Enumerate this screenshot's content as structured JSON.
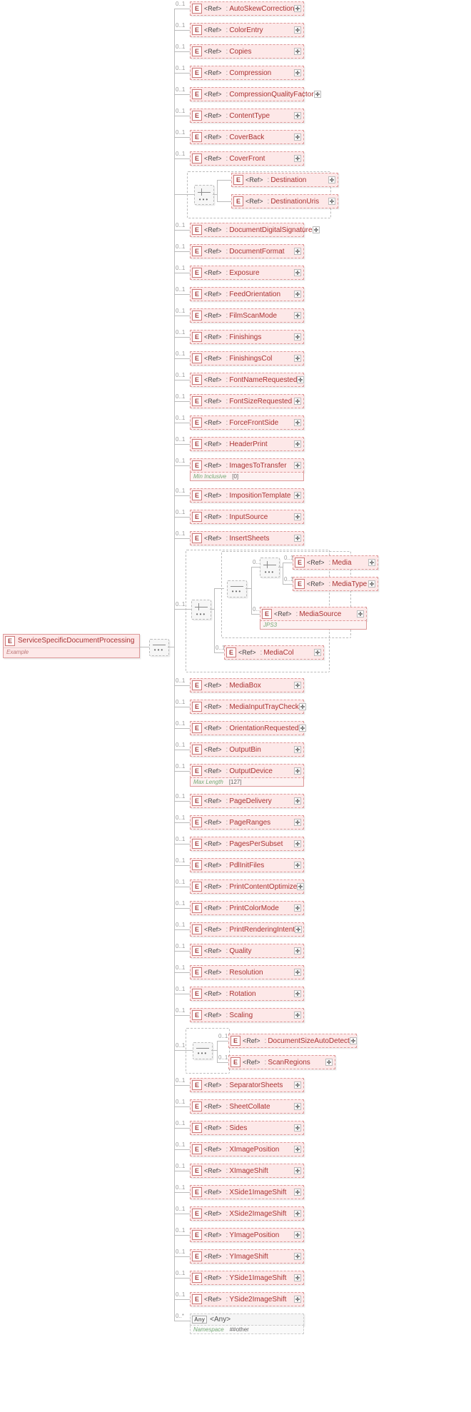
{
  "root": {
    "tag": "E",
    "name": "ServiceSpecificDocumentProcessing",
    "subLabel": "Example"
  },
  "ref_label": "<Ref>",
  "colon": ":",
  "occ_default": "0..1",
  "occ_any": "0..*",
  "occ_choice_inner": "0..1",
  "constraints": {
    "minInclusive_k": "Min Inclusive",
    "minInclusive_v": "[0]",
    "maxLength_k": "Max Length",
    "maxLength_v": "[127]",
    "jps3": "JPS3",
    "namespace_k": "Namespace",
    "namespace_v": "##other"
  },
  "children": [
    {
      "name": "AutoSkewCorrection"
    },
    {
      "name": "ColorEntry"
    },
    {
      "name": "Copies"
    },
    {
      "name": "Compression"
    },
    {
      "name": "CompressionQualityFactor"
    },
    {
      "name": "ContentType"
    },
    {
      "name": "CoverBack"
    },
    {
      "name": "CoverFront"
    },
    {
      "choice": [
        {
          "name": "Destination"
        },
        {
          "name": "DestinationUris"
        }
      ]
    },
    {
      "name": "DocumentDigitalSignature"
    },
    {
      "name": "DocumentFormat"
    },
    {
      "name": "Exposure"
    },
    {
      "name": "FeedOrientation"
    },
    {
      "name": "FilmScanMode"
    },
    {
      "name": "Finishings"
    },
    {
      "name": "FinishingsCol"
    },
    {
      "name": "FontNameRequested"
    },
    {
      "name": "FontSizeRequested"
    },
    {
      "name": "ForceFrontSide"
    },
    {
      "name": "HeaderPrint"
    },
    {
      "name": "ImagesToTransfer",
      "sub": "minInclusive"
    },
    {
      "name": "ImpositionTemplate"
    },
    {
      "name": "InputSource"
    },
    {
      "name": "InsertSheets"
    },
    {
      "media_group": true
    },
    {
      "name": "MediaBox"
    },
    {
      "name": "MediaInputTrayCheck"
    },
    {
      "name": "OrientationRequested"
    },
    {
      "name": "OutputBin"
    },
    {
      "name": "OutputDevice",
      "sub": "maxLength"
    },
    {
      "name": "PageDelivery"
    },
    {
      "name": "PageRanges"
    },
    {
      "name": "PagesPerSubset"
    },
    {
      "name": "PdlInitFiles"
    },
    {
      "name": "PrintContentOptimize"
    },
    {
      "name": "PrintColorMode"
    },
    {
      "name": "PrintRenderingIntent"
    },
    {
      "name": "Quality"
    },
    {
      "name": "Resolution"
    },
    {
      "name": "Rotation"
    },
    {
      "name": "Scaling"
    },
    {
      "scan_group": [
        {
          "name": "DocumentSizeAutoDetect"
        },
        {
          "name": "ScanRegions"
        }
      ]
    },
    {
      "name": "SeparatorSheets"
    },
    {
      "name": "SheetCollate"
    },
    {
      "name": "Sides"
    },
    {
      "name": "XImagePosition"
    },
    {
      "name": "XImageShift"
    },
    {
      "name": "XSide1ImageShift"
    },
    {
      "name": "XSide2ImageShift"
    },
    {
      "name": "YImagePosition"
    },
    {
      "name": "YImageShift"
    },
    {
      "name": "YSide1ImageShift"
    },
    {
      "name": "YSide2ImageShift"
    },
    {
      "any": true,
      "name": "<Any>"
    }
  ],
  "media_group": {
    "choice1_a": "Media",
    "choice1_b": "MediaType",
    "mediaSource": "MediaSource",
    "mediaCol": "MediaCol"
  },
  "scan_group": {
    "a": "DocumentSizeAutoDetect",
    "b": "ScanRegions"
  }
}
